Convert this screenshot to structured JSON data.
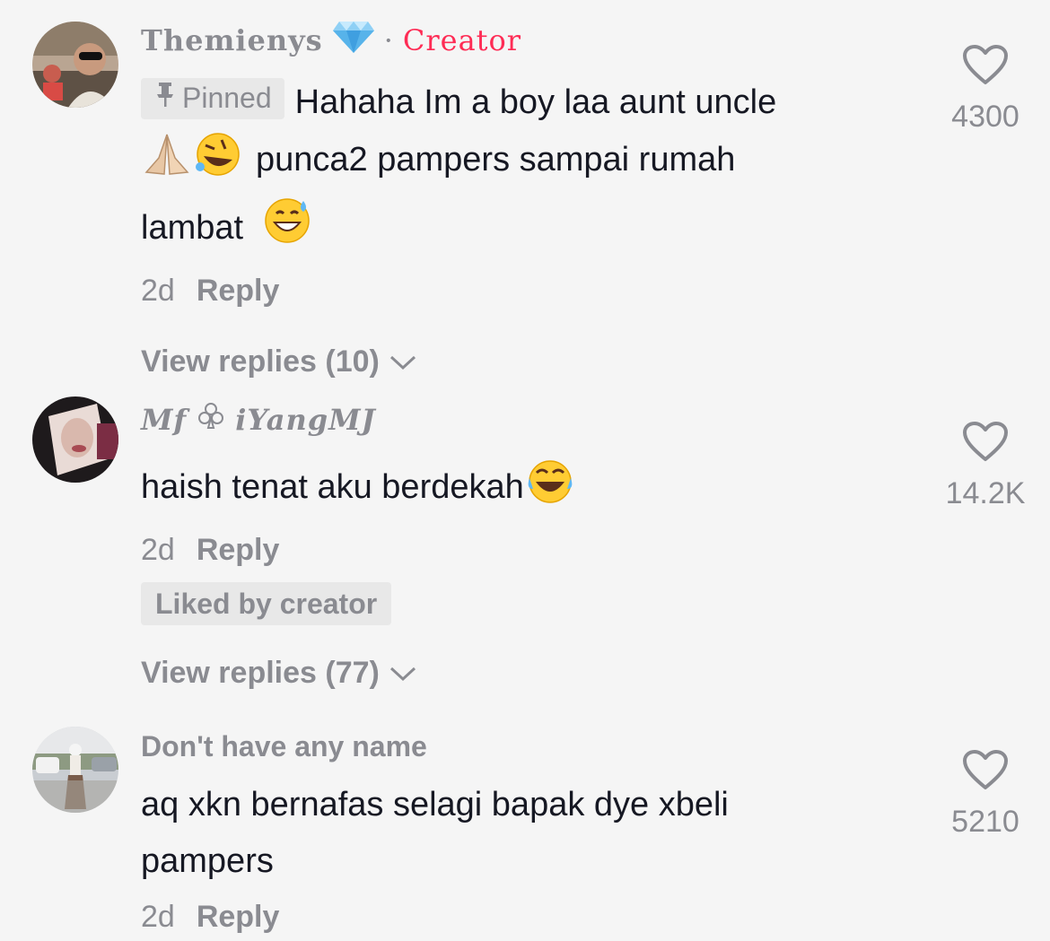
{
  "comments": [
    {
      "username": "Themienys",
      "creator_sep": "·",
      "creator_label": "Creator",
      "pinned_label": "Pinned",
      "text_a": "Hahaha Im a boy laa aunt uncle",
      "text_b": "punca2 pampers sampai rumah",
      "text_c": "lambat",
      "time": "2d",
      "reply_label": "Reply",
      "view_replies": "View replies (10)",
      "likes": "4300"
    },
    {
      "username_a": "Mf",
      "username_b": "iYangMJ",
      "text": "haish tenat aku berdekah",
      "time": "2d",
      "reply_label": "Reply",
      "liked_by": "Liked by creator",
      "view_replies": "View replies (77)",
      "likes": "14.2K"
    },
    {
      "username": "Don't have any name",
      "text_a": "aq xkn bernafas selagi bapak dye xbeli",
      "text_b": "pampers",
      "time": "2d",
      "reply_label": "Reply",
      "likes": "5210"
    }
  ],
  "colors": {
    "accent": "#fe2c55",
    "muted": "#8a8b91",
    "text": "#161823",
    "bg": "#f5f5f5"
  }
}
